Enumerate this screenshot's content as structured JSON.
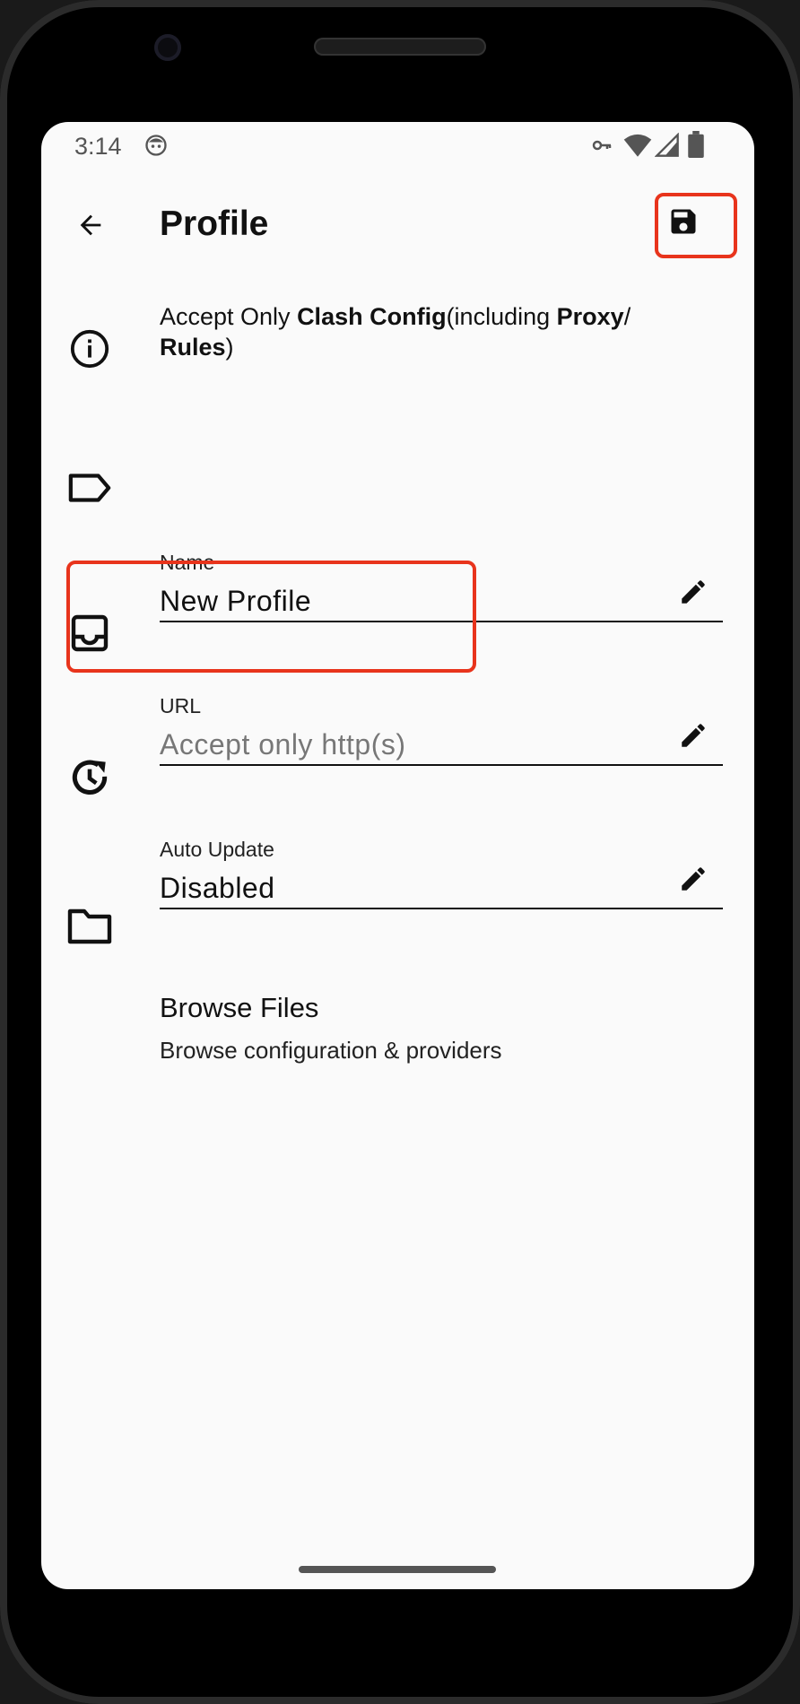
{
  "status_bar": {
    "time": "3:14"
  },
  "toolbar": {
    "title": "Profile"
  },
  "tip": {
    "parts": [
      {
        "text": "Accept Only ",
        "bold": false
      },
      {
        "text": "Clash Config",
        "bold": true
      },
      {
        "text": "(including ",
        "bold": false
      },
      {
        "text": "Proxy",
        "bold": true
      },
      {
        "text": "/ ",
        "bold": false
      },
      {
        "text": "Rules",
        "bold": true
      },
      {
        "text": ")",
        "bold": false
      }
    ]
  },
  "fields": {
    "name": {
      "label": "Name",
      "value": "New Profile"
    },
    "url": {
      "label": "URL",
      "placeholder": "Accept only http(s)"
    },
    "auto_update": {
      "label": "Auto Update",
      "value": "Disabled"
    }
  },
  "browse": {
    "title": "Browse Files",
    "subtitle": "Browse configuration & providers"
  },
  "colors": {
    "highlight": "#e8341c",
    "background": "#fafafa",
    "text": "#111111"
  },
  "icons": {
    "back": "arrow-left-icon",
    "save": "floppy-disk-icon",
    "info": "info-circle-icon",
    "name": "label-tag-icon",
    "url": "inbox-icon",
    "auto_update": "update-clock-icon",
    "browse": "folder-icon",
    "edit": "pencil-icon"
  }
}
